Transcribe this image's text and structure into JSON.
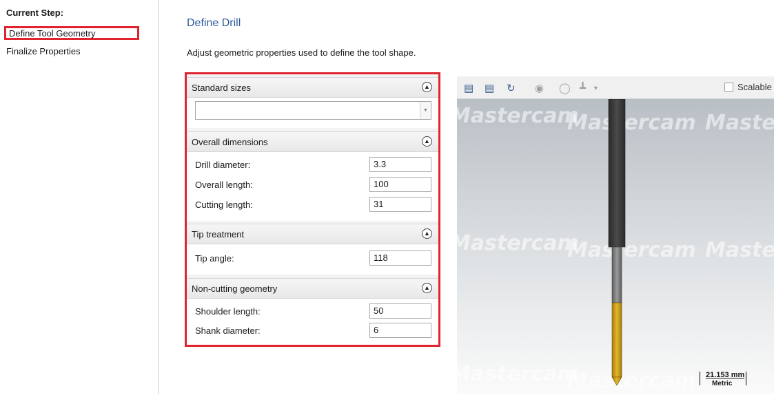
{
  "steps": {
    "header": "Current Step:",
    "items": [
      {
        "label": "Define Tool Geometry"
      },
      {
        "label": "Finalize Properties"
      }
    ]
  },
  "page": {
    "title": "Define Drill",
    "description": "Adjust geometric properties used to define the tool shape."
  },
  "form": {
    "standard_sizes": {
      "header": "Standard sizes",
      "value": ""
    },
    "overall": {
      "header": "Overall dimensions",
      "drill_diameter": {
        "label": "Drill diameter:",
        "value": "3.3"
      },
      "overall_length": {
        "label": "Overall length:",
        "value": "100"
      },
      "cutting_length": {
        "label": "Cutting length:",
        "value": "31"
      }
    },
    "tip": {
      "header": "Tip treatment",
      "tip_angle": {
        "label": "Tip angle:",
        "value": "118"
      }
    },
    "noncut": {
      "header": "Non-cutting geometry",
      "shoulder_length": {
        "label": "Shoulder length:",
        "value": "50"
      },
      "shank_diameter": {
        "label": "Shank diameter:",
        "value": "6"
      }
    }
  },
  "preview": {
    "scalable_label": "Scalable",
    "scalable_checked": false,
    "scale_value": "21.153 mm",
    "scale_unit": "Metric",
    "watermark": "Mastercam"
  },
  "colors": {
    "accent_red": "#e0232f",
    "title_blue": "#2d5a9e",
    "shank": "#3a3a3a",
    "shoulder": "#7c7c7c",
    "flute": "#d4a51c"
  }
}
